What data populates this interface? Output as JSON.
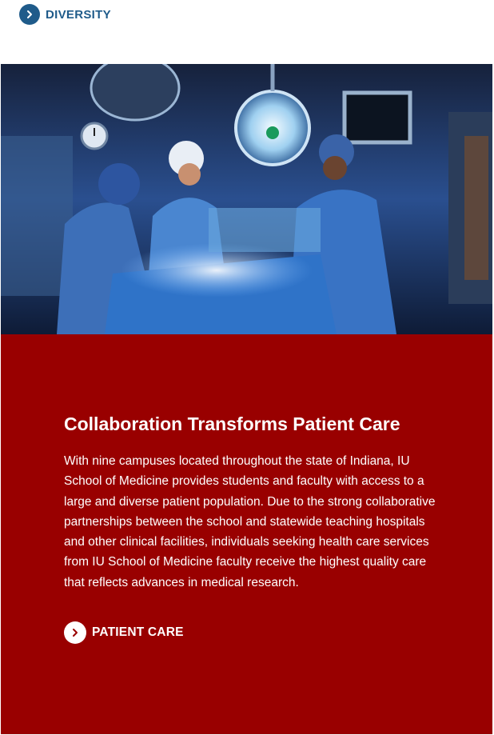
{
  "top_link": {
    "label": "DIVERSITY",
    "icon": "chevron-right-icon"
  },
  "hero": {
    "alt": "Surgical team in operating room"
  },
  "panel": {
    "title": "Collaboration Transforms Patient Care",
    "body": "With nine campuses located throughout the state of Indiana, IU School of Medicine provides students and faculty with access to a large and diverse patient population. Due to the strong collaborative partnerships between the school and statewide teaching hospitals and other clinical facilities, individuals seeking health care services from IU School of Medicine faculty receive the highest quality care that reflects advances in medical research.",
    "cta_label": "PATIENT CARE",
    "cta_icon": "chevron-right-icon"
  },
  "colors": {
    "link_blue": "#1f5b8a",
    "panel_red": "#990000"
  }
}
